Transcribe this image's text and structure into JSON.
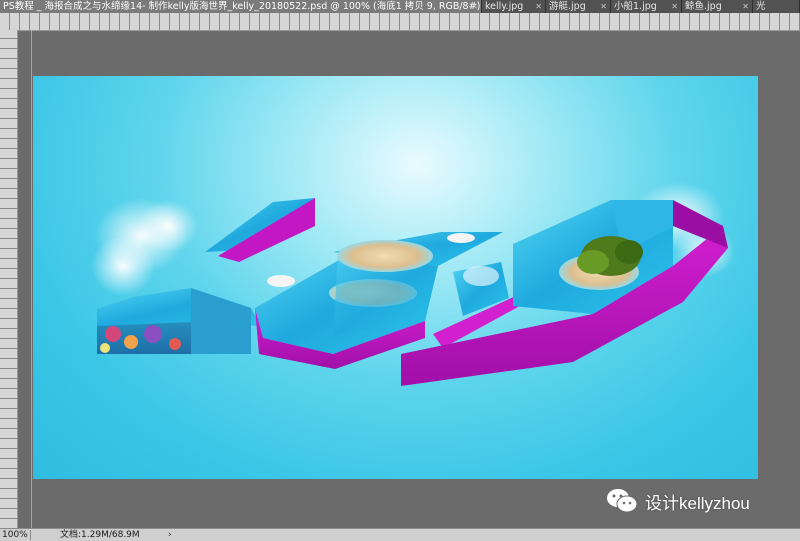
{
  "tabs": [
    {
      "label": "PS教程 _ 海报合成之与水缔缘14- 制作kelly版海世界_kelly_20180522.psd @ 100% (海底1 拷贝 9, RGB/8#) *",
      "active": true
    },
    {
      "label": "kelly.jpg",
      "active": false
    },
    {
      "label": "游艇.jpg",
      "active": false
    },
    {
      "label": "小船1.jpg",
      "active": false
    },
    {
      "label": "鲸鱼.jpg",
      "active": false
    },
    {
      "label": "光",
      "active": false
    }
  ],
  "status": {
    "zoom": "100%",
    "doc_size": "文档:1.29M/68.9M",
    "arrow": "›"
  },
  "watermark": {
    "text": "设计kellyzhou",
    "icon": "wechat-icon"
  },
  "colors": {
    "canvas_bg": "#3ac6e6",
    "letter_side": "#c417c4",
    "water": "#2ab6e2",
    "guide": "#35d5e0",
    "workspace": "#6b6b6b"
  },
  "canvas_artwork": "3D letters 'kelly' built from ocean water with magenta extruded sides, sand islands, boats and a tree-covered island"
}
